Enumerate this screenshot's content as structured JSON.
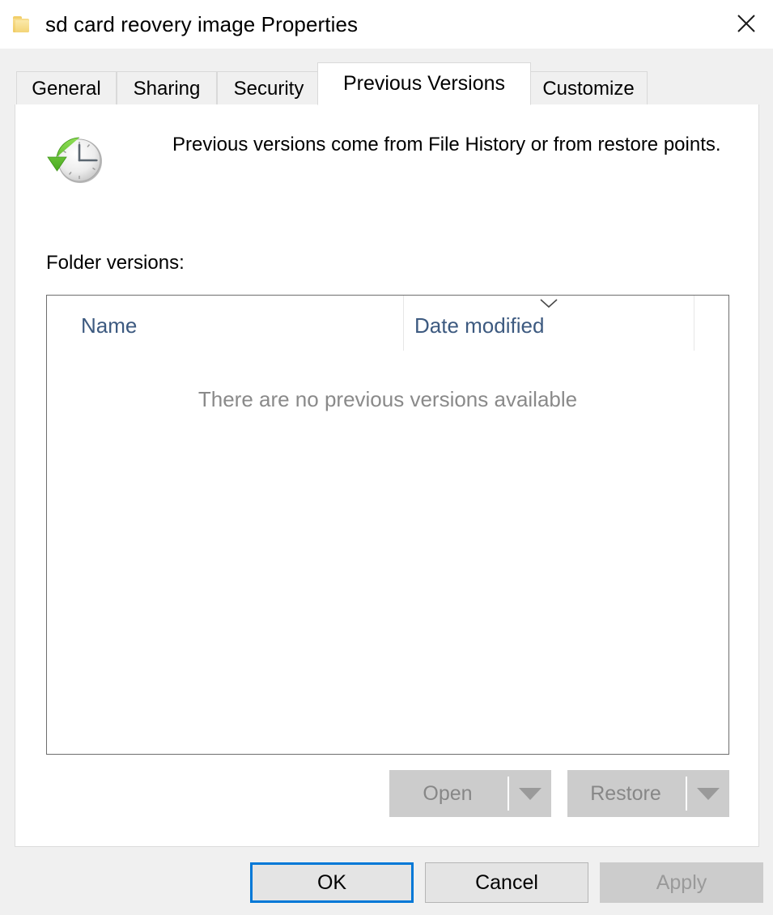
{
  "window": {
    "title": "sd card reovery image Properties",
    "folder_icon": "folder-icon",
    "close_icon": "close-icon"
  },
  "tabs": [
    {
      "label": "General",
      "active": false
    },
    {
      "label": "Sharing",
      "active": false
    },
    {
      "label": "Security",
      "active": false
    },
    {
      "label": "Previous Versions",
      "active": true
    },
    {
      "label": "Customize",
      "active": false
    }
  ],
  "content": {
    "icon": "clock-restore-icon",
    "description": "Previous versions come from File History or from restore points.",
    "section_label": "Folder versions:"
  },
  "list": {
    "columns": [
      {
        "label": "Name",
        "sorted": false
      },
      {
        "label": "Date modified",
        "sorted": true,
        "sort_direction": "descending"
      }
    ],
    "rows": [],
    "empty_message": "There are no previous versions available",
    "sort_indicator_icon": "chevron-down-icon"
  },
  "actions": {
    "open": {
      "label": "Open",
      "enabled": false,
      "dropdown_icon": "caret-down-icon"
    },
    "restore": {
      "label": "Restore",
      "enabled": false,
      "dropdown_icon": "caret-down-icon"
    }
  },
  "footer": {
    "ok": {
      "label": "OK",
      "enabled": true,
      "default": true
    },
    "cancel": {
      "label": "Cancel",
      "enabled": true
    },
    "apply": {
      "label": "Apply",
      "enabled": false
    }
  },
  "colors": {
    "accent": "#0078d7",
    "dialog_background": "#f0f0f0",
    "panel_background": "#ffffff",
    "column_header_text": "#3d5a80",
    "disabled_text": "#878787",
    "empty_text": "#8a8a8a"
  }
}
